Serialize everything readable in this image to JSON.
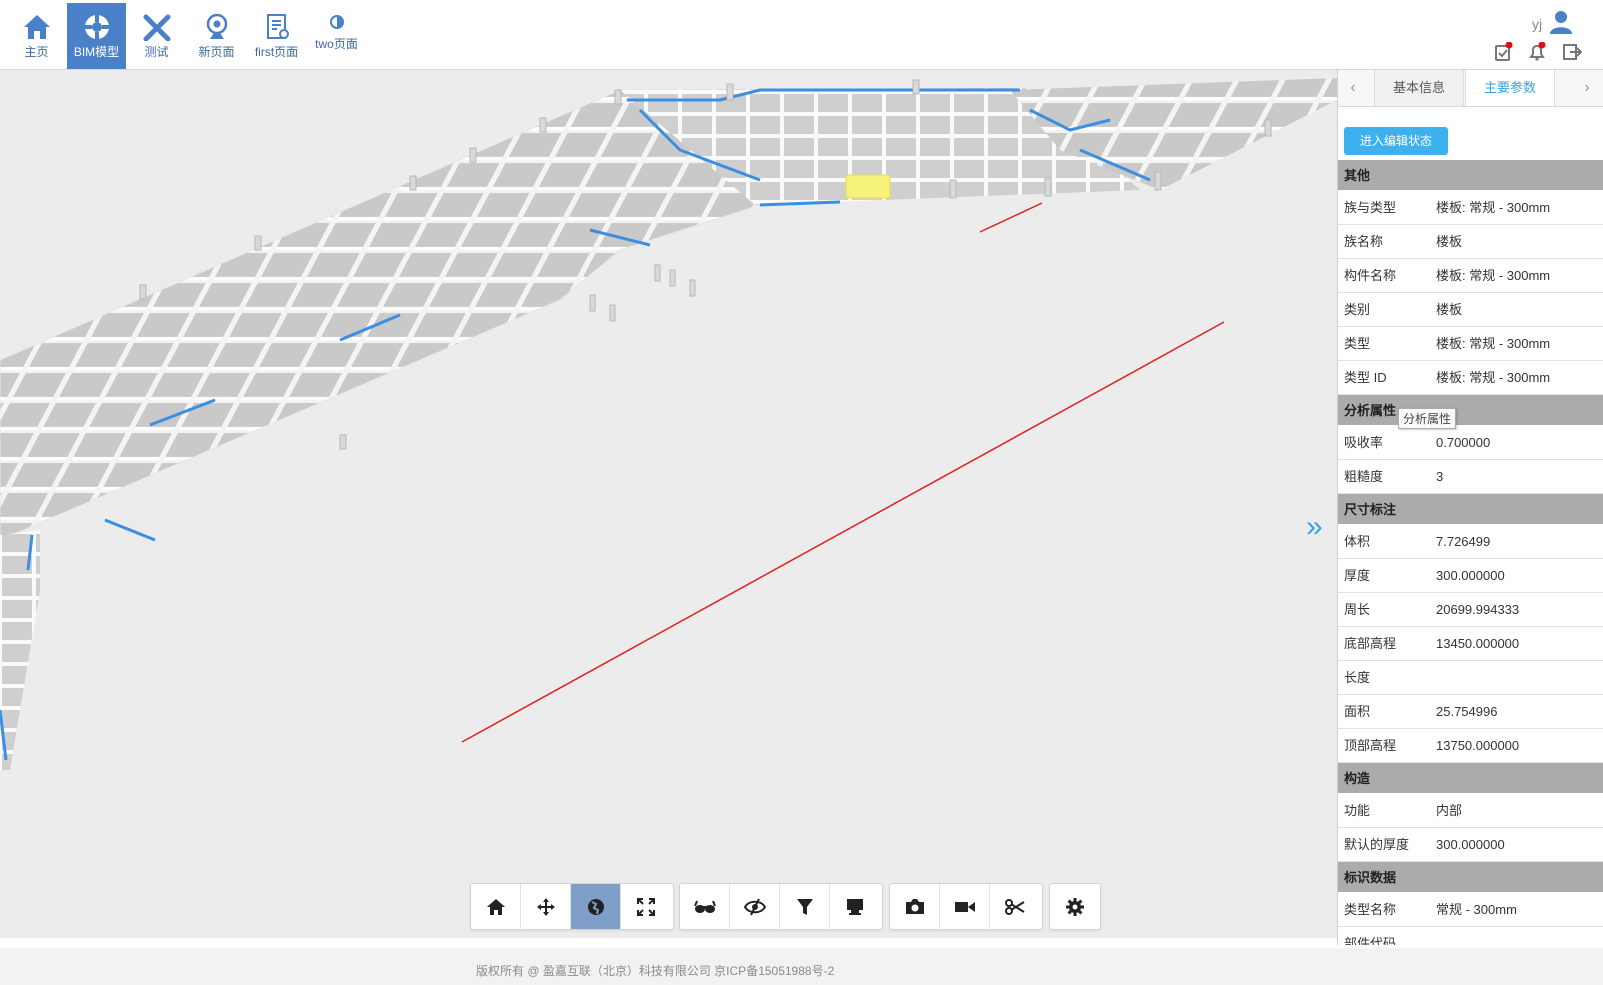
{
  "nav": {
    "items": [
      {
        "label": "主页",
        "icon": "home-icon"
      },
      {
        "label": "BIM模型",
        "icon": "lifebuoy-icon"
      },
      {
        "label": "测试",
        "icon": "tools-icon"
      },
      {
        "label": "新页面",
        "icon": "webcam-icon"
      },
      {
        "label": "first页面",
        "icon": "doc-settings-icon"
      },
      {
        "label": "two页面",
        "icon": "contrast-icon"
      }
    ],
    "active": "BIM模型"
  },
  "user": {
    "name": "yj"
  },
  "colors": {
    "accent": "#3aa0e8",
    "nav_active": "#4a80c8",
    "selected_element": "#f7f27a",
    "axis_line": "#e02020"
  },
  "panel": {
    "tabs": [
      "基本信息",
      "主要参数"
    ],
    "active_tab": "主要参数",
    "edit_button": "进入编辑状态",
    "tooltip": "分析属性",
    "sections": [
      {
        "title": "其他",
        "rows": [
          {
            "key": "族与类型",
            "value": "楼板: 常规 - 300mm"
          },
          {
            "key": "族名称",
            "value": "楼板"
          },
          {
            "key": "构件名称",
            "value": "楼板: 常规 - 300mm"
          },
          {
            "key": "类别",
            "value": "楼板"
          },
          {
            "key": "类型",
            "value": "楼板: 常规 - 300mm"
          },
          {
            "key": "类型 ID",
            "value": "楼板: 常规 - 300mm"
          }
        ]
      },
      {
        "title": "分析属性",
        "rows": [
          {
            "key": "吸收率",
            "value": "0.700000"
          },
          {
            "key": "粗糙度",
            "value": "3"
          }
        ]
      },
      {
        "title": "尺寸标注",
        "rows": [
          {
            "key": "体积",
            "value": "7.726499"
          },
          {
            "key": "厚度",
            "value": "300.000000"
          },
          {
            "key": "周长",
            "value": "20699.994333"
          },
          {
            "key": "底部高程",
            "value": "13450.000000"
          },
          {
            "key": "长度",
            "value": ""
          },
          {
            "key": "面积",
            "value": "25.754996"
          },
          {
            "key": "顶部高程",
            "value": "13750.000000"
          }
        ]
      },
      {
        "title": "构造",
        "rows": [
          {
            "key": "功能",
            "value": "内部"
          },
          {
            "key": "默认的厚度",
            "value": "300.000000"
          }
        ]
      },
      {
        "title": "标识数据",
        "rows": [
          {
            "key": "类型名称",
            "value": "常规 - 300mm"
          },
          {
            "key": "部件代码",
            "value": ""
          }
        ]
      }
    ]
  },
  "toolbar": {
    "groups": [
      [
        "home-view-icon",
        "move-icon",
        "orbit-globe-icon",
        "fullscreen-icon"
      ],
      [
        "glasses-icon",
        "hide-icon",
        "filter-icon",
        "annotation-icon"
      ],
      [
        "camera-icon",
        "video-icon",
        "section-cut-icon"
      ],
      [
        "settings-icon"
      ]
    ],
    "active": "orbit-globe-icon"
  },
  "footer": {
    "text": "版权所有 @ 盈嘉互联（北京）科技有限公司 京ICP备15051988号-2"
  }
}
